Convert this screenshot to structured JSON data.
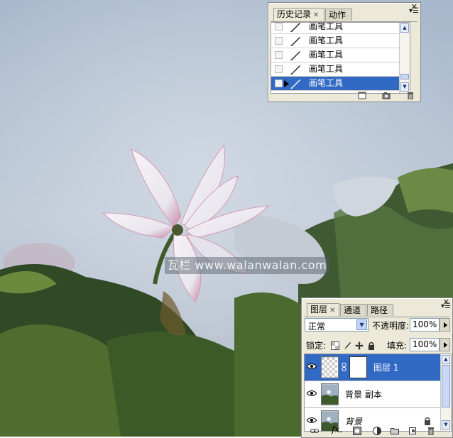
{
  "watermark": "瓦栏 www.walanwalan.com",
  "history_panel": {
    "tabs": [
      {
        "label": "历史记录",
        "active": true
      },
      {
        "label": "动作",
        "active": false
      }
    ],
    "states": [
      {
        "label": "画笔工具",
        "selected": false
      },
      {
        "label": "画笔工具",
        "selected": false
      },
      {
        "label": "画笔工具",
        "selected": false
      },
      {
        "label": "画笔工具",
        "selected": false
      },
      {
        "label": "画笔工具",
        "selected": true
      }
    ],
    "footer_icons": [
      "new-document-from-state-icon",
      "snapshot-camera-icon",
      "trash-icon"
    ]
  },
  "layers_panel": {
    "tabs": [
      {
        "label": "图层",
        "active": true
      },
      {
        "label": "通道",
        "active": false
      },
      {
        "label": "路径",
        "active": false
      }
    ],
    "blend_mode": "正常",
    "opacity_label": "不透明度:",
    "opacity_value": "100%",
    "lock_label": "锁定:",
    "fill_label": "填充:",
    "fill_value": "100%",
    "layers": [
      {
        "name": "图层 1",
        "selected": true,
        "visible": true,
        "has_mask": true
      },
      {
        "name": "背景 副本",
        "selected": false,
        "visible": true,
        "has_mask": false
      },
      {
        "name": "背景",
        "selected": false,
        "visible": true,
        "has_mask": false,
        "locked": true
      }
    ],
    "footer_icons": [
      "link-layers-icon",
      "fx-icon",
      "add-mask-icon",
      "adjustment-layer-icon",
      "new-group-icon",
      "new-layer-icon",
      "trash-icon"
    ]
  },
  "colors": {
    "selection": "#316ac5",
    "panel_bg": "#ece9d8",
    "sky": "#b8c6d8"
  }
}
